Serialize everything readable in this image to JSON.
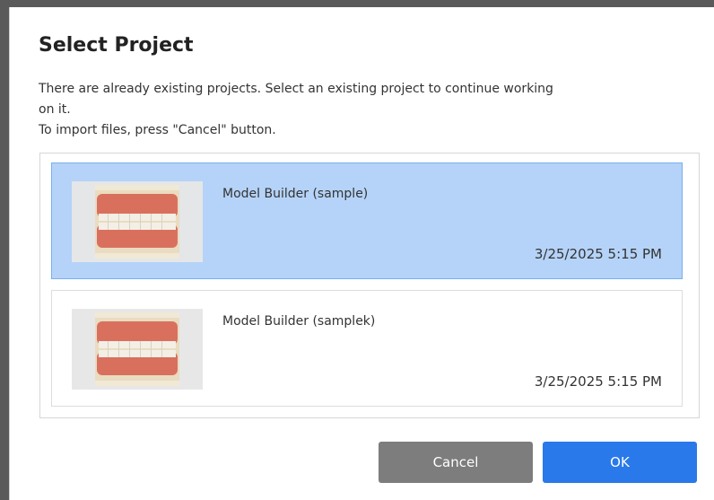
{
  "dialog": {
    "title": "Select Project",
    "description_line1": "There are already existing projects. Select an existing project to continue working",
    "description_line2": "on it.",
    "description_line3": "To import files, press \"Cancel\" button."
  },
  "projects": [
    {
      "name": "Model Builder (sample)",
      "date": "3/25/2025 5:15 PM",
      "selected": true,
      "thumbnail_icon": "dental-model-thumbnail"
    },
    {
      "name": "Model Builder (samplek)",
      "date": "3/25/2025 5:15 PM",
      "selected": false,
      "thumbnail_icon": "dental-model-thumbnail"
    }
  ],
  "buttons": {
    "cancel_label": "Cancel",
    "ok_label": "OK"
  },
  "colors": {
    "selected_row": "#b5d3f8",
    "ok_button": "#2979ea",
    "cancel_button": "#7d7d7d"
  }
}
